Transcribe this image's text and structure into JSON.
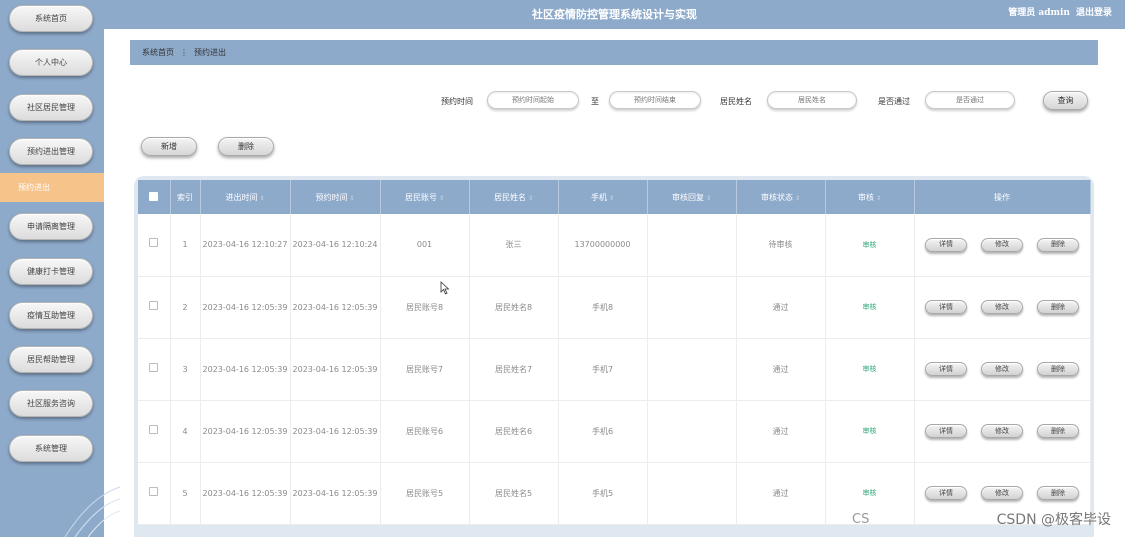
{
  "header": {
    "title": "社区疫情防控管理系统设计与实现",
    "user": "管理员 admin",
    "logout": "退出登录"
  },
  "sidebar": {
    "items": [
      {
        "label": "系统首页"
      },
      {
        "label": "个人中心"
      },
      {
        "label": "社区居民管理"
      },
      {
        "label": "预约进出管理"
      },
      {
        "label": "预约进出",
        "active": true
      },
      {
        "label": "申请隔离管理"
      },
      {
        "label": "健康打卡管理"
      },
      {
        "label": "疫情互助管理"
      },
      {
        "label": "居民帮助管理"
      },
      {
        "label": "社区服务咨询"
      },
      {
        "label": "系统管理"
      }
    ]
  },
  "breadcrumb": {
    "home": "系统首页",
    "current": "预约进出"
  },
  "search": {
    "time_label": "预约时间",
    "time_start_placeholder": "预约时间起始",
    "to_label": "至",
    "time_end_placeholder": "预约时间结束",
    "name_label": "居民姓名",
    "name_placeholder": "居民姓名",
    "passed_label": "是否通过",
    "passed_placeholder": "是否通过",
    "query_button": "查询"
  },
  "actions": {
    "add": "新增",
    "delete": "删除"
  },
  "table": {
    "headers": [
      "索引",
      "进出时间",
      "预约时间",
      "居民账号",
      "居民姓名",
      "手机",
      "审核回复",
      "审核状态",
      "审核",
      "操作"
    ],
    "review_link": "审核",
    "btn_detail": "详情",
    "btn_edit": "修改",
    "btn_delete": "删除",
    "rows": [
      {
        "index": "1",
        "inout_time": "2023-04-16 12:10:27",
        "reserve_time": "2023-04-16 12:10:24",
        "account": "001",
        "name": "张三",
        "phone": "13700000000",
        "reply": "",
        "status": "待审核"
      },
      {
        "index": "2",
        "inout_time": "2023-04-16 12:05:39",
        "reserve_time": "2023-04-16 12:05:39",
        "account": "居民账号8",
        "name": "居民姓名8",
        "phone": "手机8",
        "reply": "",
        "status": "通过"
      },
      {
        "index": "3",
        "inout_time": "2023-04-16 12:05:39",
        "reserve_time": "2023-04-16 12:05:39",
        "account": "居民账号7",
        "name": "居民姓名7",
        "phone": "手机7",
        "reply": "",
        "status": "通过"
      },
      {
        "index": "4",
        "inout_time": "2023-04-16 12:05:39",
        "reserve_time": "2023-04-16 12:05:39",
        "account": "居民账号6",
        "name": "居民姓名6",
        "phone": "手机6",
        "reply": "",
        "status": "通过"
      },
      {
        "index": "5",
        "inout_time": "2023-04-16 12:05:39",
        "reserve_time": "2023-04-16 12:05:39",
        "account": "居民账号5",
        "name": "居民姓名5",
        "phone": "手机5",
        "reply": "",
        "status": "通过"
      }
    ]
  },
  "watermark": {
    "text": "CSDN @极客毕设",
    "partial": "CS"
  }
}
